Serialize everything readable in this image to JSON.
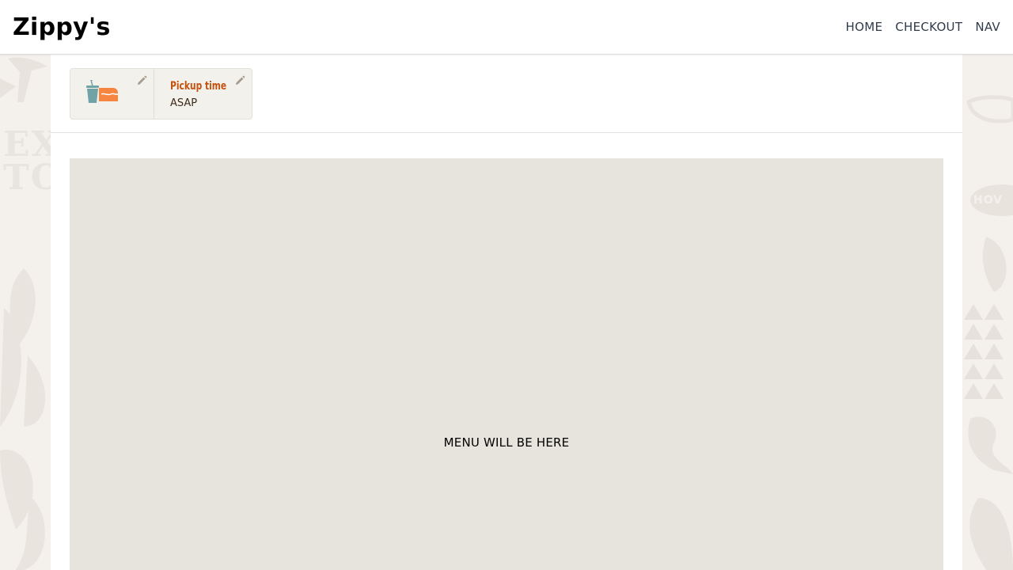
{
  "brand": "Zippy's",
  "nav": {
    "home": "HOME",
    "checkout": "CHECKOUT",
    "nav": "NAV"
  },
  "order": {
    "pickup_label": "Pickup time",
    "pickup_value": "ASAP"
  },
  "menu": {
    "placeholder_text": "MENU WILL BE HERE"
  },
  "background": {
    "left_words": [
      "EXT",
      "TOP"
    ],
    "right_word": "HOV"
  },
  "colors": {
    "accent": "#c4530f",
    "page_background": "#f4f1ec",
    "placeholder_background": "#e7e4dd",
    "cup_teal": "#6fa3a6",
    "box_orange": "#f5853f"
  }
}
